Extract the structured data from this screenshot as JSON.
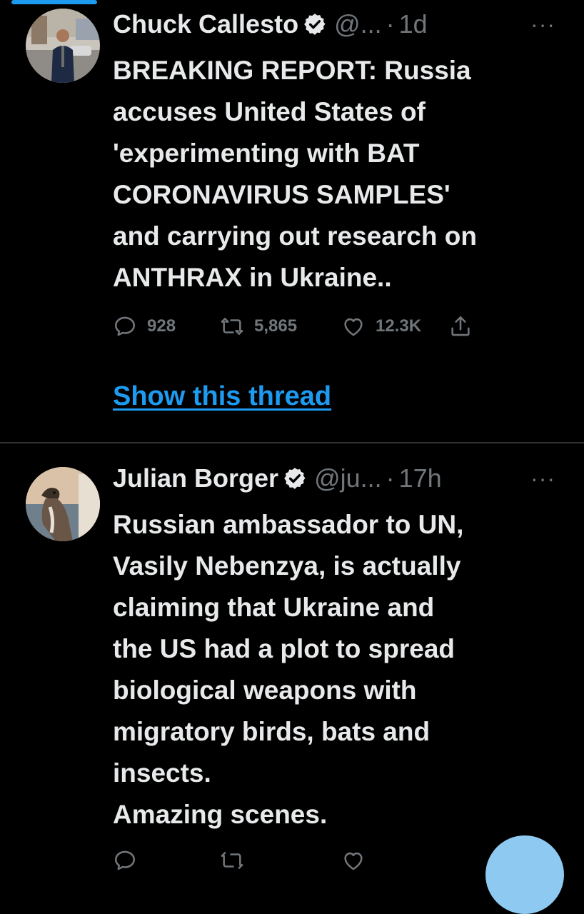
{
  "tweets": [
    {
      "author": "Chuck Callesto",
      "handle": "@...",
      "time": "1d",
      "dot": "·",
      "more": "···",
      "lines": [
        "BREAKING REPORT: Russia",
        "accuses United States of",
        "'experimenting with BAT",
        "CORONAVIRUS SAMPLES'",
        "and carrying out research on",
        "ANTHRAX in Ukraine.."
      ],
      "replies": "928",
      "retweets": "5,865",
      "likes": "12.3K",
      "show_thread": "Show this thread"
    },
    {
      "author": "Julian Borger",
      "handle": "@ju...",
      "time": "17h",
      "dot": "·",
      "more": "···",
      "lines": [
        "Russian ambassador to UN,",
        "Vasily Nebenzya, is actually",
        "claiming that Ukraine and",
        "the US had a plot to spread",
        "biological weapons with",
        "migratory birds, bats and",
        "insects.",
        "Amazing scenes."
      ]
    }
  ],
  "icons": {
    "verified": "verified-badge-icon",
    "reply": "reply-icon",
    "retweet": "retweet-icon",
    "like": "heart-icon",
    "share": "share-icon"
  },
  "colors": {
    "background": "#000000",
    "text": "#e7e9ea",
    "muted": "#71767b",
    "accent": "#1d9bf0"
  }
}
